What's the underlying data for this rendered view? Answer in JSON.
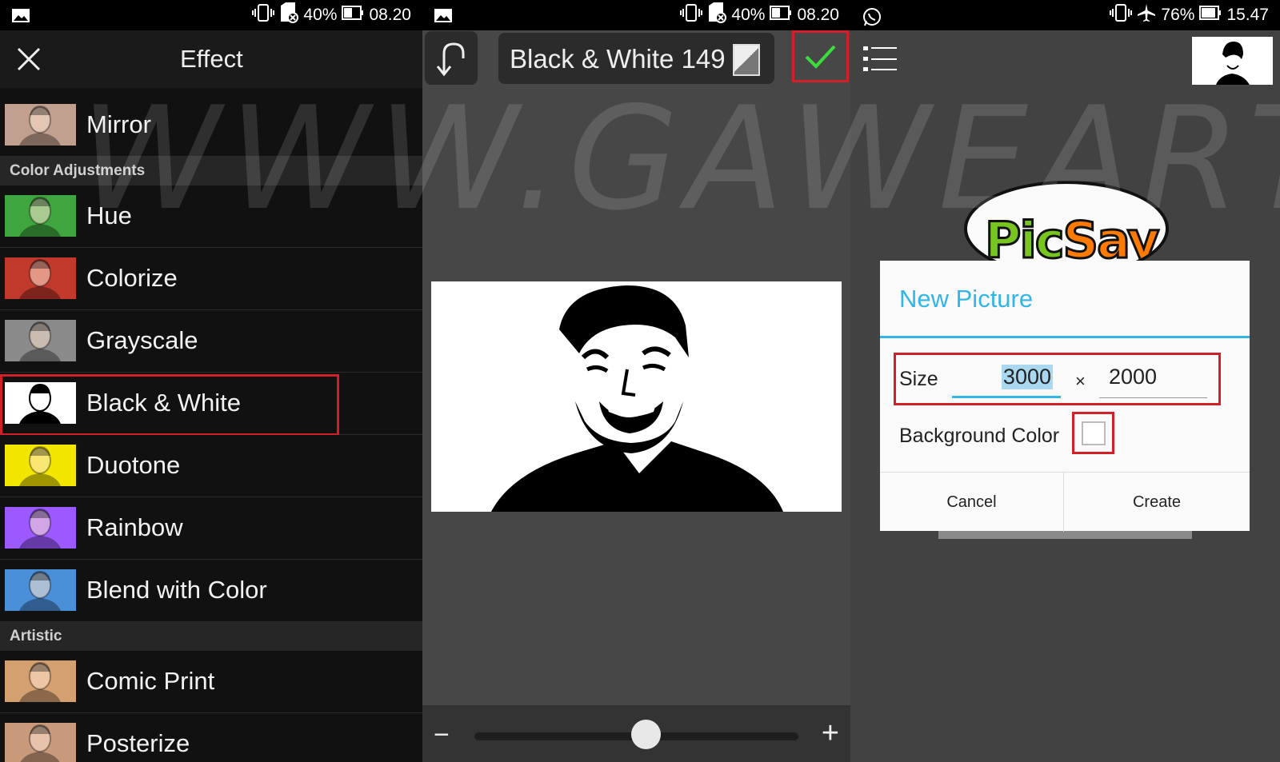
{
  "status_bars": [
    {
      "battery": "40%",
      "time": "08.20"
    },
    {
      "battery": "40%",
      "time": "08.20"
    },
    {
      "battery": "76%",
      "time": "15.47"
    }
  ],
  "effect_panel": {
    "title": "Effect",
    "items": [
      {
        "type": "row",
        "label": "Mirror",
        "tint": "#c2a090"
      },
      {
        "type": "section",
        "label": "Color Adjustments"
      },
      {
        "type": "row",
        "label": "Hue",
        "tint": "#3fa63f"
      },
      {
        "type": "row",
        "label": "Colorize",
        "tint": "#c0392b"
      },
      {
        "type": "row",
        "label": "Grayscale",
        "tint": "#8a8a8a"
      },
      {
        "type": "row",
        "label": "Black & White",
        "tint": "#000000",
        "selected": true
      },
      {
        "type": "row",
        "label": "Duotone",
        "tint": "#f2e600"
      },
      {
        "type": "row",
        "label": "Rainbow",
        "tint": "#9b59ff"
      },
      {
        "type": "row",
        "label": "Blend with Color",
        "tint": "#4a90d9"
      },
      {
        "type": "section",
        "label": "Artistic"
      },
      {
        "type": "row",
        "label": "Comic Print",
        "tint": "#d4a070"
      },
      {
        "type": "row",
        "label": "Posterize",
        "tint": "#c89a7a"
      }
    ]
  },
  "editor_panel": {
    "filter_name": "Black & White 149",
    "slider_level": 0.53,
    "minus": "−",
    "plus": "+"
  },
  "new_picture_panel": {
    "logo": {
      "part1": "Pic",
      "part2": "Say"
    },
    "dialog": {
      "title": "New Picture",
      "size_label": "Size",
      "width": "3000",
      "times": "×",
      "height": "2000",
      "bg_label": "Background Color",
      "cancel": "Cancel",
      "create": "Create"
    }
  },
  "watermark": "WWW.GAWEART.COM",
  "colors": {
    "accent": "#33b5e5",
    "highlight": "#d0202a",
    "check": "#3ddc3d"
  }
}
